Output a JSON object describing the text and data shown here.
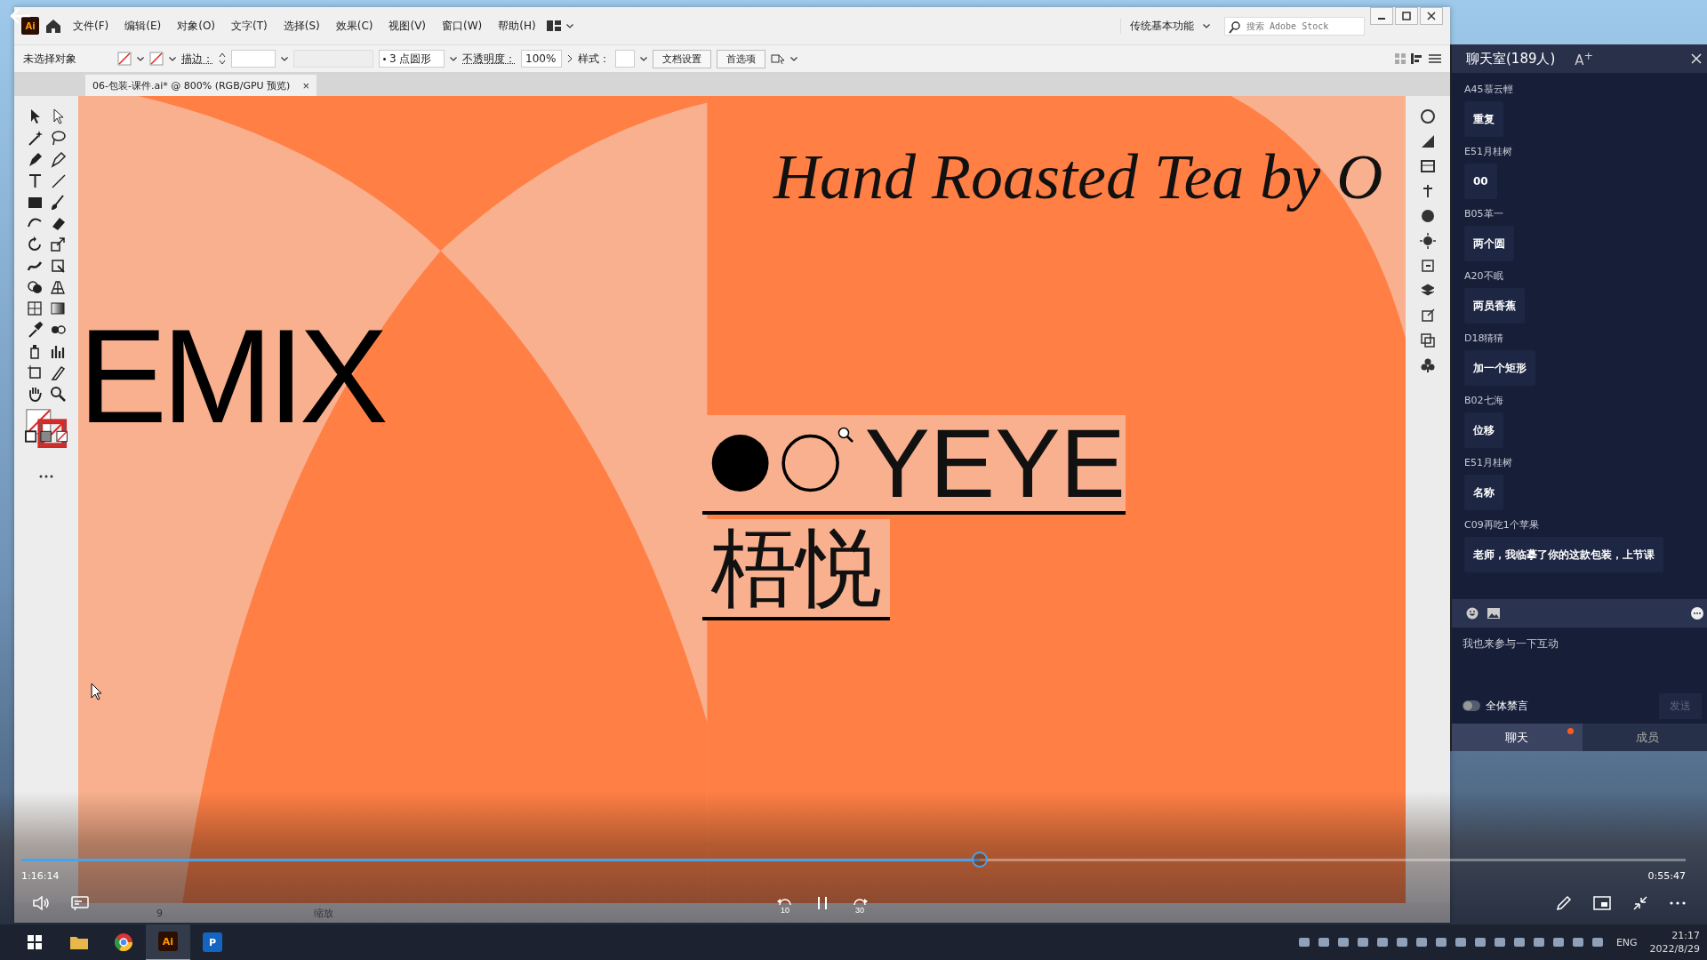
{
  "app_window": {
    "logo": "Ai",
    "menu": [
      "文件(F)",
      "编辑(E)",
      "对象(O)",
      "文字(T)",
      "选择(S)",
      "效果(C)",
      "视图(V)",
      "窗口(W)",
      "帮助(H)"
    ],
    "workspace": "传统基本功能",
    "search": {
      "placeholder": "搜索 Adobe Stock"
    }
  },
  "control_bar": {
    "selection": "未选择对象",
    "stroke_label": "描边：",
    "brush": "3 点圆形",
    "opacity_label": "不透明度：",
    "opacity": "100%",
    "style_label": "样式：",
    "buttons": [
      "文档设置",
      "首选项"
    ]
  },
  "document_tab": {
    "title": "06-包装-课件.ai* @ 800% (RGB/GPU 预览)",
    "close": "×"
  },
  "artwork": {
    "headline": "Hand Roasted Tea by O",
    "brand_partial": "EMIX",
    "logo_text": "YEYE",
    "chinese_name": "梧悦"
  },
  "status_bar": {
    "page": "9",
    "zoom_label": "缩放"
  },
  "chat": {
    "title": "聊天室(189人)",
    "font_button": "A$^{+}$",
    "messages": [
      {
        "user": "A45慕云輕",
        "text": "重复"
      },
      {
        "user": "E51月桂树",
        "text": "00"
      },
      {
        "user": "B05革一",
        "text": "两个圆"
      },
      {
        "user": "A20不眠",
        "text": "两员香蕉"
      },
      {
        "user": "D18猜猜",
        "text": "加一个矩形"
      },
      {
        "user": "B02七海",
        "text": "位移"
      },
      {
        "user": "E51月桂树",
        "text": "名称"
      },
      {
        "user": "C09再吃1个苹果",
        "text": "老师，我临摹了你的这款包装，上节课"
      }
    ],
    "input": {
      "placeholder": "我也来参与一下互动"
    },
    "mute_all": {
      "label": "全体禁言",
      "on": false
    },
    "send": {
      "label": "发送",
      "disabled": true
    },
    "tabs": [
      {
        "label": "聊天",
        "selected": true,
        "unread": true
      },
      {
        "label": "成员",
        "selected": false,
        "unread": false
      }
    ]
  },
  "player": {
    "elapsed": "1:16:14",
    "remaining": "0:55:47",
    "progress": {
      "level": 0.576
    },
    "rewind": "10",
    "forward": "30",
    "playing": true
  },
  "taskbar": {
    "apps": [
      {
        "label": "Ai"
      },
      {
        "label": "P"
      }
    ],
    "language": "ENG",
    "time": "21:17",
    "date": "2022/8/29"
  }
}
